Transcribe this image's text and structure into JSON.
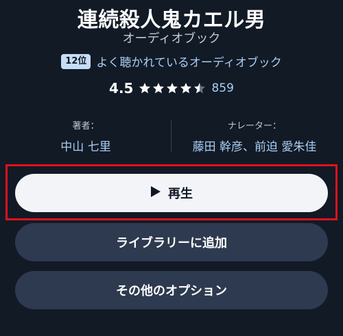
{
  "book": {
    "title": "連続殺人鬼カエル男",
    "format": "オーディオブック"
  },
  "rank": {
    "badge": "12位",
    "text": "よく聴かれているオーディオブック"
  },
  "rating": {
    "value": "4.5",
    "stars": 4.5,
    "max_stars": 5,
    "count": "859"
  },
  "credits": {
    "author_label": "著者：",
    "author": "中山 七里",
    "narrator_label": "ナレーター：",
    "narrator": "藤田 幹彦、前迫 愛朱佳"
  },
  "actions": {
    "play_label": "再生",
    "library_label": "ライブラリーに追加",
    "options_label": "その他のオプション"
  },
  "icons": {
    "play": "play-icon",
    "star": "star-icon"
  },
  "colors": {
    "background": "#121a26",
    "accent_text": "#a9cff4",
    "play_button": "#f2f4f8",
    "secondary_button": "#2d3a4f",
    "highlight_border": "#e0111b"
  }
}
